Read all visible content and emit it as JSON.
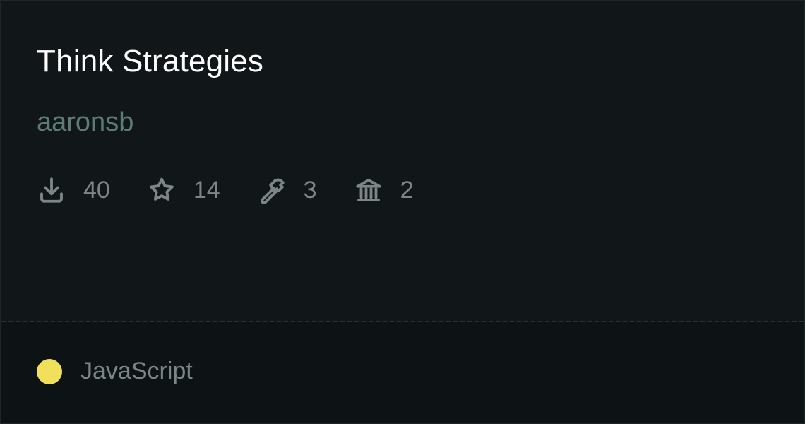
{
  "card": {
    "title": "Think Strategies",
    "author": "aaronsb",
    "stats": [
      {
        "icon": "download-icon",
        "value": "40"
      },
      {
        "icon": "star-icon",
        "value": "14"
      },
      {
        "icon": "hammer-icon",
        "value": "3"
      },
      {
        "icon": "bank-icon",
        "value": "2"
      }
    ],
    "language": {
      "label": "JavaScript",
      "color": "#f1e05a"
    }
  },
  "colors": {
    "background": "#111719",
    "footer_background": "#0d1214",
    "title": "#ffffff",
    "author": "#5d7b75",
    "muted": "#7c8688"
  }
}
